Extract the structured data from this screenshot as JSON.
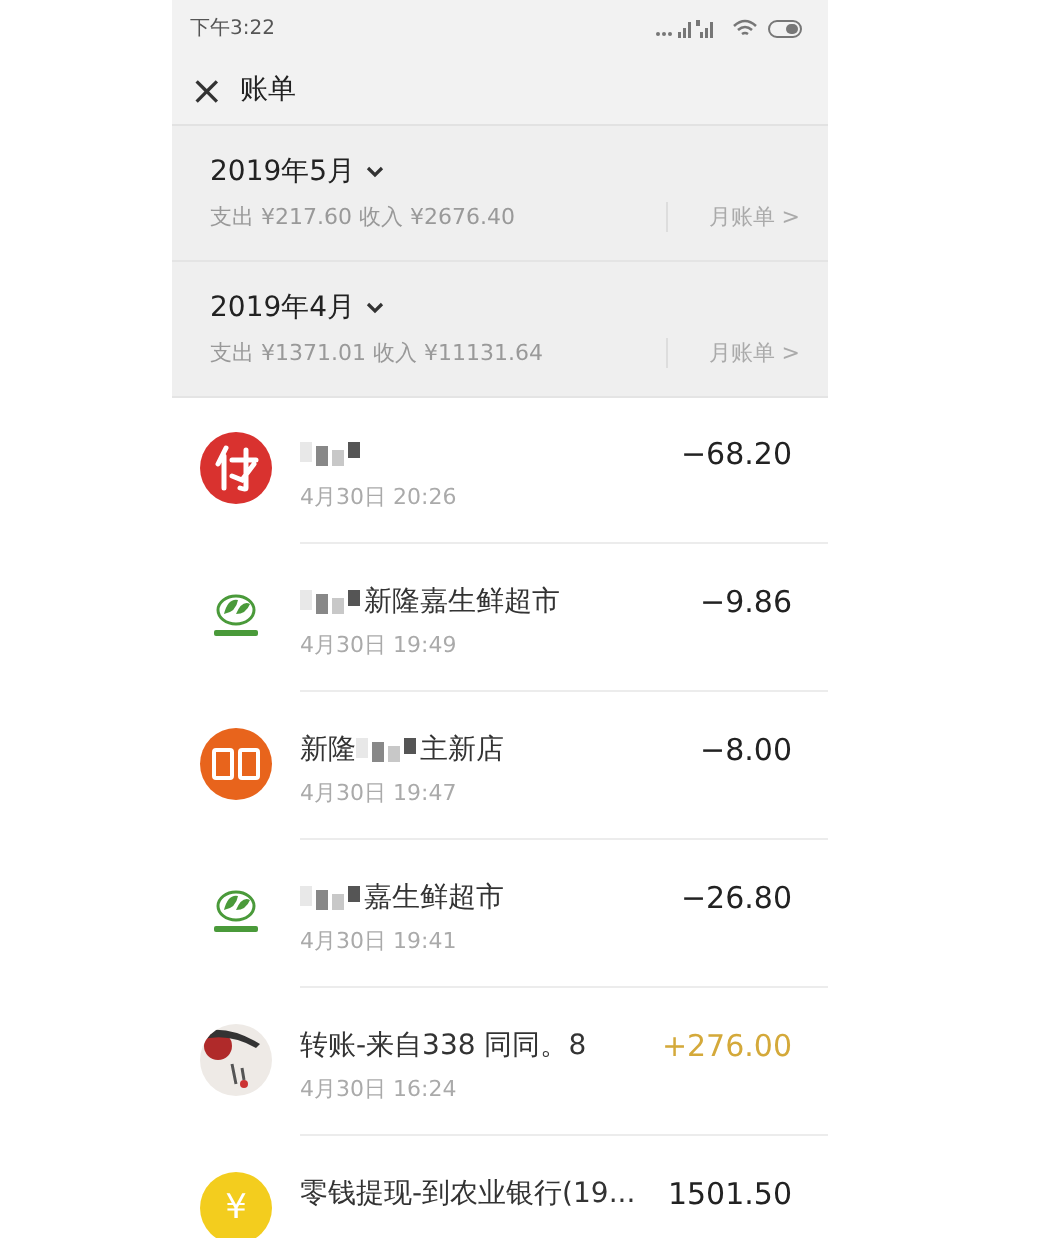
{
  "status_bar": {
    "time": "下午3:22"
  },
  "header": {
    "close": "×",
    "title": "账单"
  },
  "months": [
    {
      "label": "2019年5月",
      "summary": "支出 ¥217.60 收入 ¥2676.40",
      "link": "月账单 >"
    },
    {
      "label": "2019年4月",
      "summary": "支出 ¥1371.01 收入 ¥11131.64",
      "link": "月账单 >"
    }
  ],
  "transactions": [
    {
      "kind": "pay",
      "name": [
        {
          "kind": "blurred"
        }
      ],
      "time": "4月30日 20:26",
      "amount": "−68.20",
      "income": false
    },
    {
      "kind": "leaf",
      "name": [
        {
          "kind": "blurred"
        },
        {
          "kind": "text",
          "text": "新隆嘉生鲜超市"
        }
      ],
      "time": "4月30日 19:49",
      "amount": "−9.86",
      "income": false
    },
    {
      "kind": "orange",
      "name": [
        {
          "kind": "text",
          "text": "新隆"
        },
        {
          "kind": "blurred"
        },
        {
          "kind": "text",
          "text": "主新店"
        }
      ],
      "time": "4月30日 19:47",
      "amount": "−8.00",
      "income": false
    },
    {
      "kind": "leaf",
      "name": [
        {
          "kind": "blurred"
        },
        {
          "kind": "text",
          "text": "嘉生鲜超市"
        }
      ],
      "time": "4月30日 19:41",
      "amount": "−26.80",
      "income": false
    },
    {
      "name": [
        {
          "kind": "text",
          "text": "转账-来自338 同同。8"
        }
      ],
      "time": "4月30日 16:24",
      "amount": "+276.00",
      "income": true
    },
    {
      "kind": "coin",
      "coin": "¥",
      "name": [
        {
          "kind": "text",
          "text": "零钱提现-到农业银行(19..."
        }
      ],
      "amount": "1501.50",
      "income": false
    }
  ]
}
